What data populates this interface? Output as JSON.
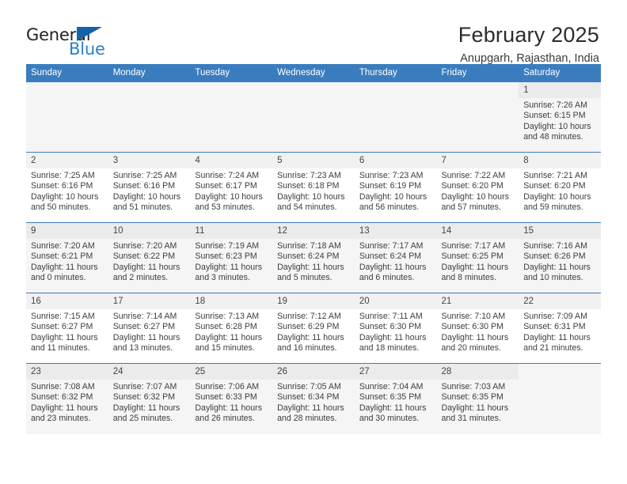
{
  "brand": {
    "word_one": "General",
    "word_two": "Blue",
    "triangle_icon": "triangle-icon"
  },
  "header": {
    "month_title": "February 2025",
    "location": "Anupgarh, Rajasthan, India"
  },
  "colors": {
    "header_blue": "#3a7dbf",
    "brand_blue": "#2a7fc9",
    "row_shade": "#f5f5f5",
    "daynum_shade": "#ebebeb"
  },
  "weekdays": [
    "Sunday",
    "Monday",
    "Tuesday",
    "Wednesday",
    "Thursday",
    "Friday",
    "Saturday"
  ],
  "labels": {
    "sunrise": "Sunrise:",
    "sunset": "Sunset:",
    "daylight": "Daylight:"
  },
  "weeks": [
    [
      {
        "empty": true
      },
      {
        "empty": true
      },
      {
        "empty": true
      },
      {
        "empty": true
      },
      {
        "empty": true
      },
      {
        "empty": true
      },
      {
        "day": "1",
        "sunrise": "Sunrise: 7:26 AM",
        "sunset": "Sunset: 6:15 PM",
        "daylight_1": "Daylight: 10 hours",
        "daylight_2": "and 48 minutes."
      }
    ],
    [
      {
        "day": "2",
        "sunrise": "Sunrise: 7:25 AM",
        "sunset": "Sunset: 6:16 PM",
        "daylight_1": "Daylight: 10 hours",
        "daylight_2": "and 50 minutes."
      },
      {
        "day": "3",
        "sunrise": "Sunrise: 7:25 AM",
        "sunset": "Sunset: 6:16 PM",
        "daylight_1": "Daylight: 10 hours",
        "daylight_2": "and 51 minutes."
      },
      {
        "day": "4",
        "sunrise": "Sunrise: 7:24 AM",
        "sunset": "Sunset: 6:17 PM",
        "daylight_1": "Daylight: 10 hours",
        "daylight_2": "and 53 minutes."
      },
      {
        "day": "5",
        "sunrise": "Sunrise: 7:23 AM",
        "sunset": "Sunset: 6:18 PM",
        "daylight_1": "Daylight: 10 hours",
        "daylight_2": "and 54 minutes."
      },
      {
        "day": "6",
        "sunrise": "Sunrise: 7:23 AM",
        "sunset": "Sunset: 6:19 PM",
        "daylight_1": "Daylight: 10 hours",
        "daylight_2": "and 56 minutes."
      },
      {
        "day": "7",
        "sunrise": "Sunrise: 7:22 AM",
        "sunset": "Sunset: 6:20 PM",
        "daylight_1": "Daylight: 10 hours",
        "daylight_2": "and 57 minutes."
      },
      {
        "day": "8",
        "sunrise": "Sunrise: 7:21 AM",
        "sunset": "Sunset: 6:20 PM",
        "daylight_1": "Daylight: 10 hours",
        "daylight_2": "and 59 minutes."
      }
    ],
    [
      {
        "day": "9",
        "sunrise": "Sunrise: 7:20 AM",
        "sunset": "Sunset: 6:21 PM",
        "daylight_1": "Daylight: 11 hours",
        "daylight_2": "and 0 minutes."
      },
      {
        "day": "10",
        "sunrise": "Sunrise: 7:20 AM",
        "sunset": "Sunset: 6:22 PM",
        "daylight_1": "Daylight: 11 hours",
        "daylight_2": "and 2 minutes."
      },
      {
        "day": "11",
        "sunrise": "Sunrise: 7:19 AM",
        "sunset": "Sunset: 6:23 PM",
        "daylight_1": "Daylight: 11 hours",
        "daylight_2": "and 3 minutes."
      },
      {
        "day": "12",
        "sunrise": "Sunrise: 7:18 AM",
        "sunset": "Sunset: 6:24 PM",
        "daylight_1": "Daylight: 11 hours",
        "daylight_2": "and 5 minutes."
      },
      {
        "day": "13",
        "sunrise": "Sunrise: 7:17 AM",
        "sunset": "Sunset: 6:24 PM",
        "daylight_1": "Daylight: 11 hours",
        "daylight_2": "and 6 minutes."
      },
      {
        "day": "14",
        "sunrise": "Sunrise: 7:17 AM",
        "sunset": "Sunset: 6:25 PM",
        "daylight_1": "Daylight: 11 hours",
        "daylight_2": "and 8 minutes."
      },
      {
        "day": "15",
        "sunrise": "Sunrise: 7:16 AM",
        "sunset": "Sunset: 6:26 PM",
        "daylight_1": "Daylight: 11 hours",
        "daylight_2": "and 10 minutes."
      }
    ],
    [
      {
        "day": "16",
        "sunrise": "Sunrise: 7:15 AM",
        "sunset": "Sunset: 6:27 PM",
        "daylight_1": "Daylight: 11 hours",
        "daylight_2": "and 11 minutes."
      },
      {
        "day": "17",
        "sunrise": "Sunrise: 7:14 AM",
        "sunset": "Sunset: 6:27 PM",
        "daylight_1": "Daylight: 11 hours",
        "daylight_2": "and 13 minutes."
      },
      {
        "day": "18",
        "sunrise": "Sunrise: 7:13 AM",
        "sunset": "Sunset: 6:28 PM",
        "daylight_1": "Daylight: 11 hours",
        "daylight_2": "and 15 minutes."
      },
      {
        "day": "19",
        "sunrise": "Sunrise: 7:12 AM",
        "sunset": "Sunset: 6:29 PM",
        "daylight_1": "Daylight: 11 hours",
        "daylight_2": "and 16 minutes."
      },
      {
        "day": "20",
        "sunrise": "Sunrise: 7:11 AM",
        "sunset": "Sunset: 6:30 PM",
        "daylight_1": "Daylight: 11 hours",
        "daylight_2": "and 18 minutes."
      },
      {
        "day": "21",
        "sunrise": "Sunrise: 7:10 AM",
        "sunset": "Sunset: 6:30 PM",
        "daylight_1": "Daylight: 11 hours",
        "daylight_2": "and 20 minutes."
      },
      {
        "day": "22",
        "sunrise": "Sunrise: 7:09 AM",
        "sunset": "Sunset: 6:31 PM",
        "daylight_1": "Daylight: 11 hours",
        "daylight_2": "and 21 minutes."
      }
    ],
    [
      {
        "day": "23",
        "sunrise": "Sunrise: 7:08 AM",
        "sunset": "Sunset: 6:32 PM",
        "daylight_1": "Daylight: 11 hours",
        "daylight_2": "and 23 minutes."
      },
      {
        "day": "24",
        "sunrise": "Sunrise: 7:07 AM",
        "sunset": "Sunset: 6:32 PM",
        "daylight_1": "Daylight: 11 hours",
        "daylight_2": "and 25 minutes."
      },
      {
        "day": "25",
        "sunrise": "Sunrise: 7:06 AM",
        "sunset": "Sunset: 6:33 PM",
        "daylight_1": "Daylight: 11 hours",
        "daylight_2": "and 26 minutes."
      },
      {
        "day": "26",
        "sunrise": "Sunrise: 7:05 AM",
        "sunset": "Sunset: 6:34 PM",
        "daylight_1": "Daylight: 11 hours",
        "daylight_2": "and 28 minutes."
      },
      {
        "day": "27",
        "sunrise": "Sunrise: 7:04 AM",
        "sunset": "Sunset: 6:35 PM",
        "daylight_1": "Daylight: 11 hours",
        "daylight_2": "and 30 minutes."
      },
      {
        "day": "28",
        "sunrise": "Sunrise: 7:03 AM",
        "sunset": "Sunset: 6:35 PM",
        "daylight_1": "Daylight: 11 hours",
        "daylight_2": "and 31 minutes."
      },
      {
        "empty": true
      }
    ]
  ]
}
